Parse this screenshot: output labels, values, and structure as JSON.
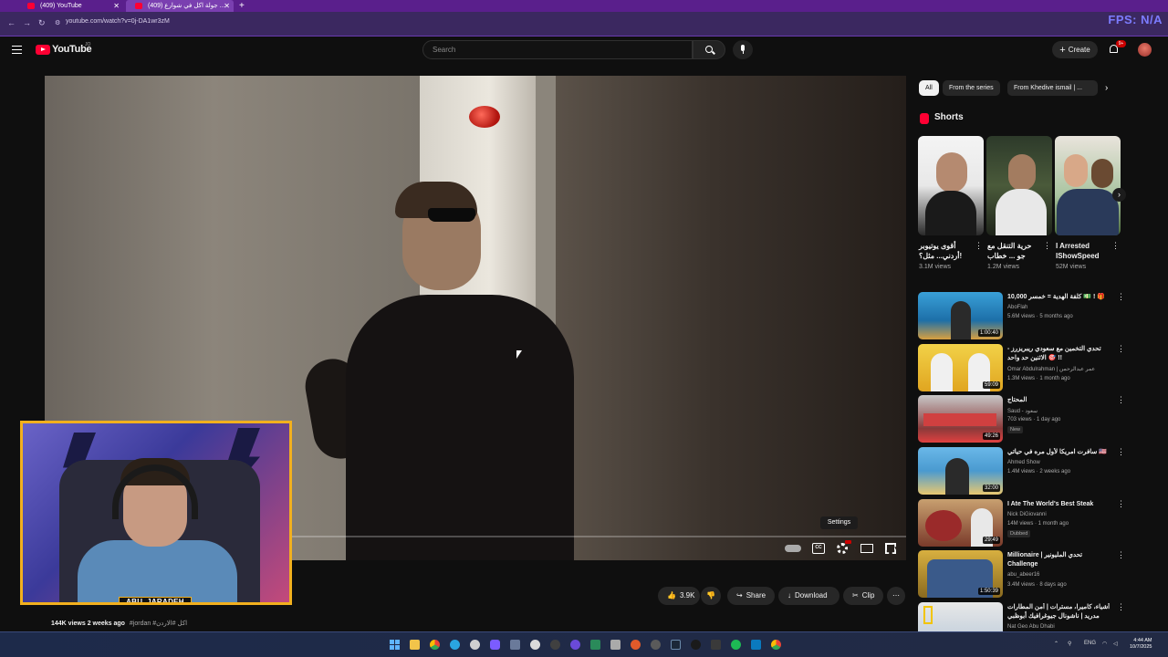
{
  "browser": {
    "tabs": [
      {
        "label": "(409) YouTube",
        "active": false
      },
      {
        "label": "(409) جولة اكل في شوارع ...",
        "active": true
      }
    ],
    "new_tab_label": "+",
    "url": "youtube.com/watch?v=0j-DA1wr3zM",
    "overlay_text": "FPS: N/A"
  },
  "header": {
    "logo_text": "YouTube",
    "logo_country": "JO",
    "search_placeholder": "Search",
    "create_label": "Create",
    "notification_count": "9+"
  },
  "player": {
    "settings_tooltip": "Settings",
    "cc_label": "CC"
  },
  "webcam": {
    "name_tag": "ABU_JARADEH"
  },
  "actions": {
    "likes": "3.9K",
    "share": "Share",
    "download": "Download",
    "clip": "Clip"
  },
  "video_meta": {
    "views": "144K views",
    "date": "2 weeks ago",
    "tags": "#jordan #اكل #الاردن"
  },
  "chips": [
    "All",
    "From the series",
    "From Khedive ismail | ..."
  ],
  "shorts": {
    "heading": "Shorts",
    "items": [
      {
        "title": "أقوى يوتيوبر أردني... مثل؟!",
        "views": "3.1M views"
      },
      {
        "title": "حرية التنقل مع جو ... خطاب",
        "views": "1.2M views"
      },
      {
        "title": "I Arrested IShowSpeed",
        "views": "52M views"
      }
    ]
  },
  "recommendations": [
    {
      "title": "كلفة الهدية = خمسر 10,000 💵 ! 🎁",
      "channel": "AboFlah",
      "meta": "5.6M views · 5 months ago",
      "duration": "1:00:40",
      "badge": ""
    },
    {
      "title": "تحدي التخمين مع سعودي ريبريزرز - الاثنين حد واحد 🎯 !!",
      "channel": "Omar Abdulrahman | عمر عبدالرحمن",
      "meta": "1.3M views · 1 month ago",
      "duration": "59:09",
      "badge": ""
    },
    {
      "title": "المحتاج",
      "channel": "Saud - سعود",
      "meta": "703 views · 1 day ago",
      "duration": "49:26",
      "badge": "New"
    },
    {
      "title": "سافرت امريكا لأول مره في حياتي 🇺🇸",
      "channel": "Ahmed Show",
      "meta": "1.4M views · 2 weeks ago",
      "duration": "32:00",
      "badge": ""
    },
    {
      "title": "I Ate The World's Best Steak",
      "channel": "Nick DiGiovanni",
      "meta": "14M views · 1 month ago",
      "duration": "29:49",
      "badge": "Dubbed"
    },
    {
      "title": "Millionaire | تحدي المليونير Challenge",
      "channel": "abu_abeer16",
      "meta": "3.4M views · 8 days ago",
      "duration": "1:50:39",
      "badge": ""
    },
    {
      "title": "أشياء، كاميرا، مسترات | أمن المطارات مدريد | ناشونال جيوغرافيك أبوظبي",
      "channel": "Nat Geo Abu Dhabi",
      "meta": "",
      "duration": "",
      "badge": ""
    }
  ],
  "taskbar": {
    "lang": "ENG",
    "time": "4:44 AM",
    "date": "10/7/2025"
  },
  "colors": {
    "accent": "#ff0033",
    "browser_tab": "#5a1f8c",
    "webcam_border": "#f2b01e"
  }
}
